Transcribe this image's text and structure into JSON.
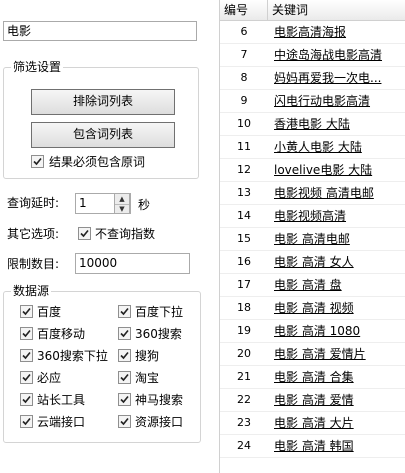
{
  "keyword_input": {
    "value": "电影"
  },
  "filter_settings": {
    "title": "筛选设置",
    "exclude_button": "排除词列表",
    "include_button": "包含词列表",
    "must_contain_label": "结果必须包含原词",
    "must_contain_checked": true
  },
  "query_delay": {
    "label": "查询延时:",
    "value": "1",
    "unit": "秒"
  },
  "other_options": {
    "label": "其它选项:",
    "no_index_label": "不查询指数",
    "no_index_checked": true
  },
  "limit": {
    "label": "限制数目:",
    "value": "10000"
  },
  "sources": {
    "title": "数据源",
    "items": [
      {
        "label": "百度",
        "checked": true
      },
      {
        "label": "百度下拉",
        "checked": true
      },
      {
        "label": "百度移动",
        "checked": true
      },
      {
        "label": "360搜索",
        "checked": true
      },
      {
        "label": "360搜索下拉",
        "checked": true
      },
      {
        "label": "搜狗",
        "checked": true
      },
      {
        "label": "必应",
        "checked": true
      },
      {
        "label": "淘宝",
        "checked": true
      },
      {
        "label": "站长工具",
        "checked": true
      },
      {
        "label": "神马搜索",
        "checked": true
      },
      {
        "label": "云端接口",
        "checked": true
      },
      {
        "label": "资源接口",
        "checked": true
      }
    ]
  },
  "table": {
    "col_num": "编号",
    "col_keyword": "关键词",
    "rows": [
      {
        "num": "6",
        "keyword": "电影高清海报"
      },
      {
        "num": "7",
        "keyword": "中途岛海战电影高清"
      },
      {
        "num": "8",
        "keyword": "妈妈再爱我一次电..."
      },
      {
        "num": "9",
        "keyword": "闪电行动电影高清"
      },
      {
        "num": "10",
        "keyword": "香港电影 大陆"
      },
      {
        "num": "11",
        "keyword": "小黄人电影 大陆"
      },
      {
        "num": "12",
        "keyword": "lovelive电影 大陆"
      },
      {
        "num": "13",
        "keyword": "电影视频 高清电邮"
      },
      {
        "num": "14",
        "keyword": "电影视频高清"
      },
      {
        "num": "15",
        "keyword": "电影 高清电邮"
      },
      {
        "num": "16",
        "keyword": "电影 高清 女人"
      },
      {
        "num": "17",
        "keyword": "电影 高清 盘"
      },
      {
        "num": "18",
        "keyword": "电影 高清 视频"
      },
      {
        "num": "19",
        "keyword": "电影 高清 1080"
      },
      {
        "num": "20",
        "keyword": "电影 高清 爱情片"
      },
      {
        "num": "21",
        "keyword": "电影 高清 合集"
      },
      {
        "num": "22",
        "keyword": "电影 高清 爱情"
      },
      {
        "num": "23",
        "keyword": "电影 高清 大片"
      },
      {
        "num": "24",
        "keyword": "电影 高清 韩国"
      }
    ]
  }
}
